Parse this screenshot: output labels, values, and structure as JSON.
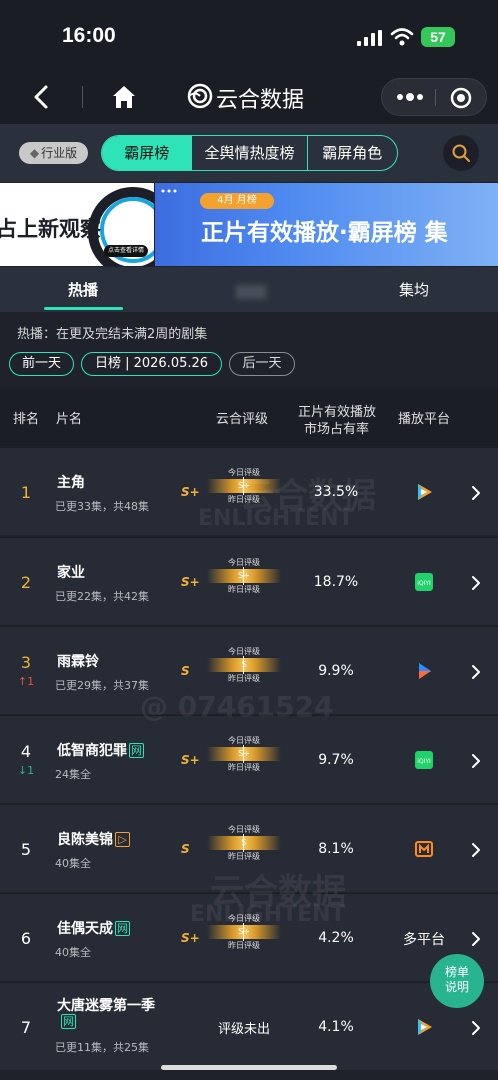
{
  "status_bar": {
    "time": "16:00",
    "battery": "57"
  },
  "navbar": {
    "brand": "云合数据"
  },
  "tabs_top": {
    "industry_badge": "行业版",
    "segments": [
      "霸屏榜",
      "全舆情热度榜",
      "霸屏角色"
    ]
  },
  "banner": {
    "left_text": "占上新观察",
    "left_pill": "点击查看详情",
    "month_tag": "4月 月榜",
    "right_title": "正片有效播放·霸屏榜 集"
  },
  "sub_tabs": {
    "active": "热播",
    "third": "集均"
  },
  "description": "热播：在更及完结未满2周的剧集",
  "date_chips": {
    "prev": "前一天",
    "date": "日榜 | 2026.05.26",
    "next": "后一天"
  },
  "table_header": {
    "rank": "排名",
    "title": "片名",
    "rating": "云合评级",
    "share_line1": "正片有效播放",
    "share_line2": "市场占有率",
    "platform": "播放平台"
  },
  "rating_labels": {
    "today": "今日评级",
    "yesterday": "昨日评级"
  },
  "rows": [
    {
      "rank": "1",
      "change": "",
      "name": "主角",
      "tag": "",
      "episodes": "已更33集，共48集",
      "grade": "S+",
      "bar": "S+",
      "share": "33.5%",
      "platform": "tencent"
    },
    {
      "rank": "2",
      "change": "",
      "name": "家业",
      "tag": "",
      "episodes": "已更22集，共42集",
      "grade": "S+",
      "bar": "S+",
      "share": "18.7%",
      "platform": "iqiyi"
    },
    {
      "rank": "3",
      "change": "↑1",
      "name": "雨霖铃",
      "tag": "",
      "episodes": "已更29集，共37集",
      "grade": "S",
      "bar": "S",
      "share": "9.9%",
      "platform": "youku"
    },
    {
      "rank": "4",
      "change": "↓1",
      "name": "低智商犯罪",
      "tag": "网",
      "episodes": "24集全",
      "grade": "S+",
      "bar": "S+",
      "share": "9.7%",
      "platform": "iqiyi"
    },
    {
      "rank": "5",
      "change": "",
      "name": "良陈美锦",
      "tag": "▷",
      "episodes": "40集全",
      "grade": "S",
      "bar": "S",
      "share": "8.1%",
      "platform": "mango"
    },
    {
      "rank": "6",
      "change": "",
      "name": "佳偶天成",
      "tag": "网",
      "episodes": "40集全",
      "grade": "S+",
      "bar": "S+",
      "share": "4.2%",
      "platform_text": "多平台"
    },
    {
      "rank": "7",
      "change": "",
      "name": "大唐迷雾第一季",
      "tag": "网",
      "episodes": "已更11集，共25集",
      "grade": "",
      "no_grade": "评级未出",
      "share": "4.1%",
      "platform": "tencent"
    }
  ],
  "float_button": {
    "line1": "榜单",
    "line2": "说明"
  },
  "watermarks": {
    "brand": "云合数据",
    "brand_en": "ENLIGHTENT",
    "id": "@ 07461524"
  },
  "colors": {
    "accent": "#2ee3b8",
    "gold": "#f2b233",
    "up": "#e5533d",
    "down": "#27b48f"
  }
}
